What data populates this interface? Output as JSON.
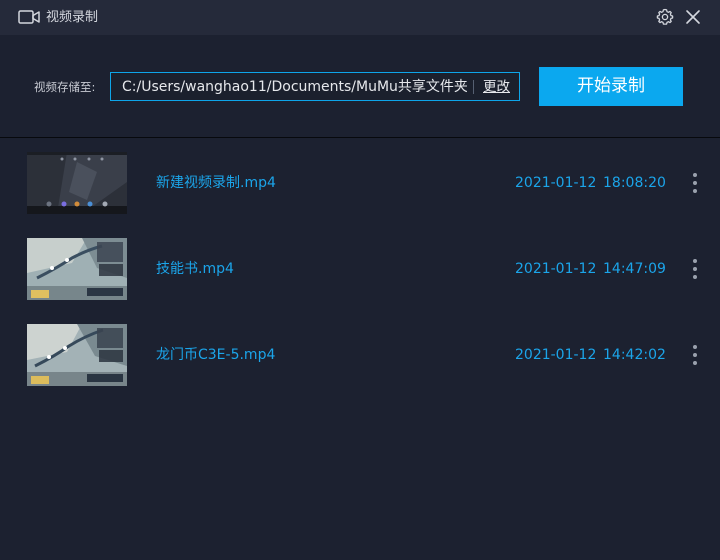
{
  "window": {
    "title": "视频录制",
    "icons": {
      "title": "video-camera-icon",
      "settings": "gear-icon",
      "close": "close-icon"
    }
  },
  "toolbar": {
    "save_label": "视频存储至:",
    "path_value": "C:/Users/wanghao11/Documents/MuMu共享文件夹",
    "change_label": "更改",
    "start_label": "开始录制"
  },
  "recordings": [
    {
      "name": "新建视频录制.mp4",
      "date": "2021-01-12",
      "time": "18:08:20",
      "thumb": "home-screen"
    },
    {
      "name": "技能书.mp4",
      "date": "2021-01-12",
      "time": "14:47:09",
      "thumb": "game-scene"
    },
    {
      "name": "龙门币C3E-5.mp4",
      "date": "2021-01-12",
      "time": "14:42:02",
      "thumb": "game-scene"
    }
  ],
  "colors": {
    "background": "#1c2130",
    "titlebar": "#252a3a",
    "accent": "#0ba8ef",
    "link": "#1ba5ea"
  }
}
